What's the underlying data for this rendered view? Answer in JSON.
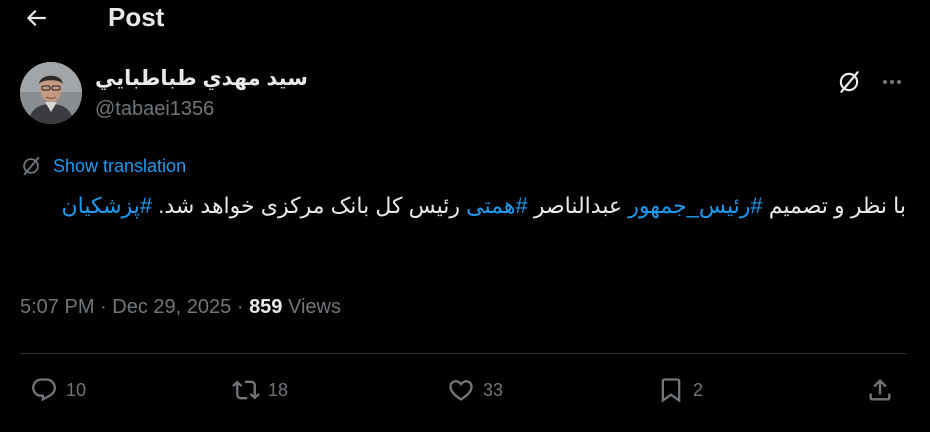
{
  "header": {
    "title": "Post"
  },
  "author": {
    "display_name": "سيد مهدي طباطبايي",
    "handle": "@tabaei1356"
  },
  "translate": {
    "label": "Show translation"
  },
  "tweet": {
    "line1_before": "با نظر و تصمیم ",
    "hashtag1": "#رئیس_جمهور",
    "line1_middle": "  عبدالناصر ",
    "hashtag2": "#همتی",
    "line1_after": " رئیس کل بانک مرکزی خواهد شد. ",
    "hashtag3": "#پزشکیان"
  },
  "meta": {
    "time": "5:07 PM",
    "separator": "·",
    "date": "Dec 29, 2025",
    "views_count": "859",
    "views_label": "Views"
  },
  "actions": {
    "replies": "10",
    "reposts": "18",
    "likes": "33",
    "bookmarks": "2"
  },
  "colors": {
    "background": "#000000",
    "text": "#e7e9ea",
    "muted": "#71767b",
    "accent": "#1d9bf0",
    "divider": "#2f3336"
  },
  "icons": [
    "back-arrow-icon",
    "grok-icon",
    "more-icon",
    "translate-icon",
    "reply-icon",
    "repost-icon",
    "like-icon",
    "bookmark-icon",
    "share-icon"
  ]
}
